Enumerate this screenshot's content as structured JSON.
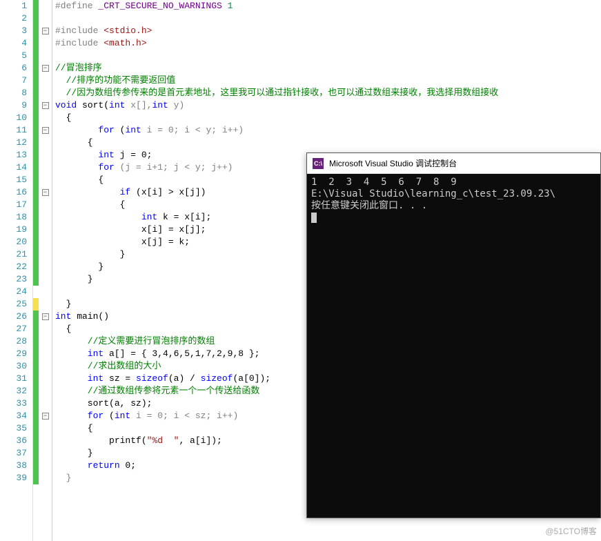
{
  "editor": {
    "lines": [
      1,
      2,
      3,
      4,
      5,
      6,
      7,
      8,
      9,
      10,
      11,
      12,
      13,
      14,
      15,
      16,
      17,
      18,
      19,
      20,
      21,
      22,
      23,
      24,
      25,
      26,
      27,
      28,
      29,
      30,
      31,
      32,
      33,
      34,
      35,
      36,
      37,
      38,
      39
    ],
    "marker": [
      "green",
      "green",
      "green",
      "green",
      "green",
      "green",
      "green",
      "green",
      "green",
      "green",
      "green",
      "green",
      "green",
      "green",
      "green",
      "green",
      "green",
      "green",
      "green",
      "green",
      "green",
      "green",
      "green",
      "none",
      "yellow",
      "green",
      "green",
      "green",
      "green",
      "green",
      "green",
      "green",
      "green",
      "green",
      "green",
      "green",
      "green",
      "green",
      "green"
    ],
    "fold": [
      "",
      "",
      "m",
      "",
      "",
      "m",
      "",
      "",
      "m",
      "",
      "m",
      "",
      "",
      "",
      "",
      "m",
      "",
      "",
      "",
      "",
      "",
      "",
      "",
      "",
      "",
      "m",
      "",
      "",
      "",
      "",
      "",
      "",
      "",
      "m",
      "",
      "",
      "",
      "",
      ""
    ],
    "code": {
      "l1": {
        "t": "#define",
        "a": "pp"
      },
      "l1b": {
        "t": " _CRT_SECURE_NO_WARNINGS",
        "a": "mac"
      },
      "l1c": {
        "t": " 1",
        "a": "num"
      },
      "l3": {
        "t": "#include",
        "a": "pp"
      },
      "l3b": {
        "t": " <stdio.h>",
        "a": "hdr"
      },
      "l4": {
        "t": "#include",
        "a": "pp"
      },
      "l4b": {
        "t": " <math.h>",
        "a": "hdr"
      },
      "l6": {
        "t": "//冒泡排序",
        "a": "cm"
      },
      "l7": {
        "t": "  //排序的功能不需要返回值",
        "a": "cm"
      },
      "l8": {
        "t": "  //因为数组传参传来的是首元素地址，这里我可以通过指针接收，也可以通过数组来接收，我选择用数组接收",
        "a": "cm"
      },
      "l9a": {
        "t": "void",
        "a": "kw"
      },
      "l9b": {
        "t": " sort(",
        "a": "fn"
      },
      "l9c": {
        "t": "int",
        "a": "kw"
      },
      "l9d": {
        "t": " x[],",
        "a": "par"
      },
      "l9e": {
        "t": "int",
        "a": "kw"
      },
      "l9f": {
        "t": " y)",
        "a": "par"
      },
      "l10": {
        "t": "  {",
        "a": ""
      },
      "l11a": {
        "t": "        for",
        "a": "kw"
      },
      "l11b": {
        "t": " (",
        "a": ""
      },
      "l11c": {
        "t": "int",
        "a": "kw"
      },
      "l11d": {
        "t": " i = 0; i < y; i++)",
        "a": "par"
      },
      "l12": {
        "t": "      {",
        "a": ""
      },
      "l13a": {
        "t": "        int",
        "a": "kw"
      },
      "l13b": {
        "t": " j = 0;",
        "a": ""
      },
      "l14a": {
        "t": "        for",
        "a": "kw"
      },
      "l14b": {
        "t": " (j = i+1; j < y; j++)",
        "a": "par"
      },
      "l15": {
        "t": "        {",
        "a": ""
      },
      "l16a": {
        "t": "            if",
        "a": "kw"
      },
      "l16b": {
        "t": " (x[i] > x[j])",
        "a": ""
      },
      "l17": {
        "t": "            {",
        "a": ""
      },
      "l18a": {
        "t": "                int",
        "a": "kw"
      },
      "l18b": {
        "t": " k = x[i];",
        "a": ""
      },
      "l19": {
        "t": "                x[i] = x[j];",
        "a": ""
      },
      "l20": {
        "t": "                x[j] = k;",
        "a": ""
      },
      "l21": {
        "t": "            }",
        "a": ""
      },
      "l22": {
        "t": "        }",
        "a": ""
      },
      "l23": {
        "t": "      }",
        "a": ""
      },
      "l25": {
        "t": "  }",
        "a": ""
      },
      "l26a": {
        "t": "int",
        "a": "kw"
      },
      "l26b": {
        "t": " main()",
        "a": "fn"
      },
      "l27": {
        "t": "  {",
        "a": ""
      },
      "l28": {
        "t": "      //定义需要进行冒泡排序的数组",
        "a": "cm"
      },
      "l29a": {
        "t": "      int",
        "a": "kw"
      },
      "l29b": {
        "t": " a[] = { 3,4,6,5,1,7,2,9,8 };",
        "a": ""
      },
      "l30": {
        "t": "      //求出数组的大小",
        "a": "cm"
      },
      "l31a": {
        "t": "      int",
        "a": "kw"
      },
      "l31b": {
        "t": " sz = ",
        "a": ""
      },
      "l31c": {
        "t": "sizeof",
        "a": "kw"
      },
      "l31d": {
        "t": "(a) / ",
        "a": ""
      },
      "l31e": {
        "t": "sizeof",
        "a": "kw"
      },
      "l31f": {
        "t": "(a[0]);",
        "a": ""
      },
      "l32": {
        "t": "      //通过数组传参将元素一个一个传送给函数",
        "a": "cm"
      },
      "l33": {
        "t": "      sort(a, sz);",
        "a": ""
      },
      "l34a": {
        "t": "      for",
        "a": "kw"
      },
      "l34b": {
        "t": " (",
        "a": ""
      },
      "l34c": {
        "t": "int",
        "a": "kw"
      },
      "l34d": {
        "t": " i = 0; i < sz; i++)",
        "a": "par"
      },
      "l35": {
        "t": "      {",
        "a": ""
      },
      "l36a": {
        "t": "          printf(",
        "a": ""
      },
      "l36b": {
        "t": "\"%d  \"",
        "a": "str"
      },
      "l36c": {
        "t": ", a[i]);",
        "a": ""
      },
      "l37": {
        "t": "      }",
        "a": ""
      },
      "l38a": {
        "t": "      return",
        "a": "kw"
      },
      "l38b": {
        "t": " 0;",
        "a": ""
      },
      "l39": {
        "t": "  }",
        "a": "par"
      }
    }
  },
  "console": {
    "title": "Microsoft Visual Studio 调试控制台",
    "icon_label": "C:\\",
    "output_line1": "1  2  3  4  5  6  7  8  9",
    "output_line2": "E:\\Visual Studio\\learning_c\\test_23.09.23\\",
    "output_line3": "按任意键关闭此窗口. . ."
  },
  "watermark": "@51CTO博客"
}
